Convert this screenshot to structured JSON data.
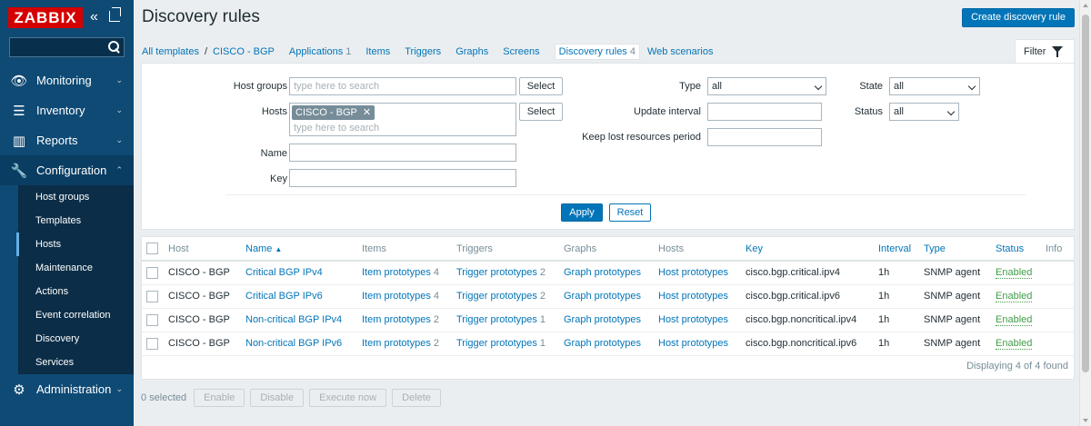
{
  "sidebar": {
    "logo": "ZABBIX",
    "collapse_glyph": "«",
    "menu": [
      {
        "label": "Monitoring",
        "icon": "eye-icon",
        "glyph": "👁"
      },
      {
        "label": "Inventory",
        "icon": "list-icon",
        "glyph": "☰"
      },
      {
        "label": "Reports",
        "icon": "chart-icon",
        "glyph": "▥"
      },
      {
        "label": "Configuration",
        "icon": "wrench-icon",
        "glyph": "🔧"
      }
    ],
    "config_submenu": [
      "Host groups",
      "Templates",
      "Hosts",
      "Maintenance",
      "Actions",
      "Event correlation",
      "Discovery",
      "Services"
    ],
    "admin": {
      "label": "Administration",
      "icon": "gear-icon",
      "glyph": "⚙"
    },
    "chevron_down": "⌄",
    "chevron_up": "⌃"
  },
  "header": {
    "title": "Discovery rules",
    "create_button": "Create discovery rule"
  },
  "nav": {
    "all_templates": "All templates",
    "separator": "/",
    "template": "CISCO - BGP",
    "applications": "Applications",
    "applications_count": "1",
    "items": "Items",
    "triggers": "Triggers",
    "graphs": "Graphs",
    "screens": "Screens",
    "discovery_rules": "Discovery rules",
    "discovery_rules_count": "4",
    "web_scenarios": "Web scenarios"
  },
  "filter": {
    "tab_label": "Filter",
    "host_groups_label": "Host groups",
    "host_groups_placeholder": "type here to search",
    "select_label": "Select",
    "hosts_label": "Hosts",
    "hosts_tag": "CISCO - BGP",
    "hosts_tag_remove": "✕",
    "hosts_placeholder": "type here to search",
    "name_label": "Name",
    "key_label": "Key",
    "type_label": "Type",
    "type_value": "all",
    "update_interval_label": "Update interval",
    "keep_lost_label": "Keep lost resources period",
    "state_label": "State",
    "state_value": "all",
    "status_label": "Status",
    "status_value": "all",
    "apply": "Apply",
    "reset": "Reset"
  },
  "table": {
    "columns": {
      "host": "Host",
      "name": "Name",
      "sort_glyph": "▲",
      "items": "Items",
      "triggers": "Triggers",
      "graphs": "Graphs",
      "hosts": "Hosts",
      "key": "Key",
      "interval": "Interval",
      "type": "Type",
      "status": "Status",
      "info": "Info"
    },
    "rows": [
      {
        "host": "CISCO - BGP",
        "name": "Critical BGP IPv4",
        "items": "Item prototypes",
        "items_count": "4",
        "triggers": "Trigger prototypes",
        "triggers_count": "2",
        "graphs": "Graph prototypes",
        "hosts": "Host prototypes",
        "key": "cisco.bgp.critical.ipv4",
        "interval": "1h",
        "type": "SNMP agent",
        "status": "Enabled"
      },
      {
        "host": "CISCO - BGP",
        "name": "Critical BGP IPv6",
        "items": "Item prototypes",
        "items_count": "4",
        "triggers": "Trigger prototypes",
        "triggers_count": "2",
        "graphs": "Graph prototypes",
        "hosts": "Host prototypes",
        "key": "cisco.bgp.critical.ipv6",
        "interval": "1h",
        "type": "SNMP agent",
        "status": "Enabled"
      },
      {
        "host": "CISCO - BGP",
        "name": "Non-critical BGP IPv4",
        "items": "Item prototypes",
        "items_count": "2",
        "triggers": "Trigger prototypes",
        "triggers_count": "1",
        "graphs": "Graph prototypes",
        "hosts": "Host prototypes",
        "key": "cisco.bgp.noncritical.ipv4",
        "interval": "1h",
        "type": "SNMP agent",
        "status": "Enabled"
      },
      {
        "host": "CISCO - BGP",
        "name": "Non-critical BGP IPv6",
        "items": "Item prototypes",
        "items_count": "2",
        "triggers": "Trigger prototypes",
        "triggers_count": "1",
        "graphs": "Graph prototypes",
        "hosts": "Host prototypes",
        "key": "cisco.bgp.noncritical.ipv6",
        "interval": "1h",
        "type": "SNMP agent",
        "status": "Enabled"
      }
    ],
    "footer": "Displaying 4 of 4 found"
  },
  "actions": {
    "selected": "0 selected",
    "enable": "Enable",
    "disable": "Disable",
    "execute_now": "Execute now",
    "delete": "Delete"
  }
}
